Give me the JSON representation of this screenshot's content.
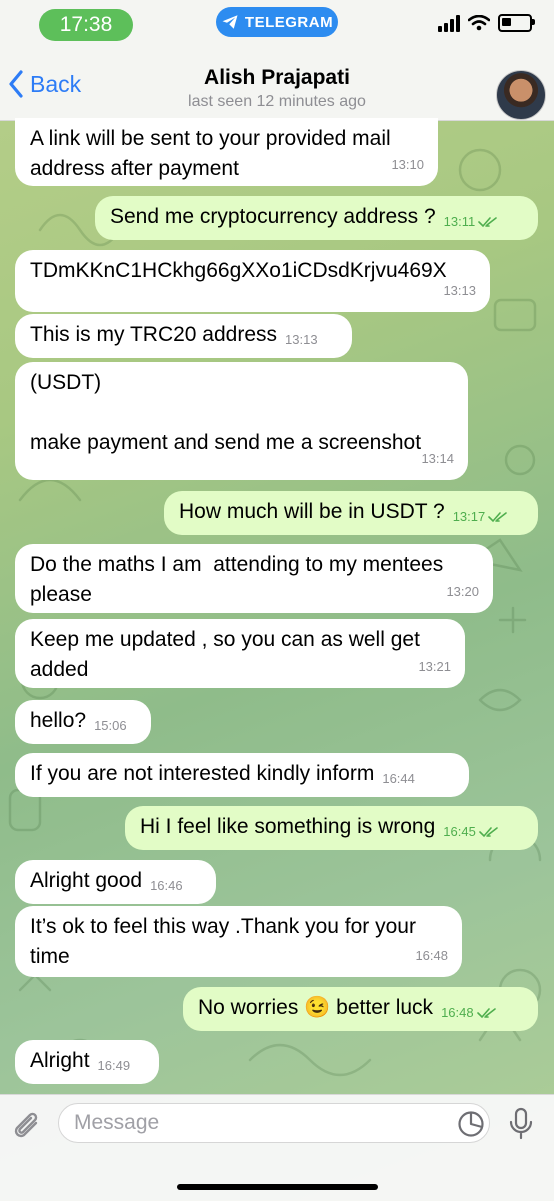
{
  "status_bar": {
    "time": "17:38",
    "app_pill": "TELEGRAM"
  },
  "header": {
    "back_label": "Back",
    "contact_name": "Alish Prajapati",
    "last_seen": "last seen 12 minutes ago"
  },
  "messages": [
    {
      "dir": "in",
      "text": "A link will be sent to your provided mail\naddress after payment",
      "time": "13:10"
    },
    {
      "dir": "out",
      "text": "Send me cryptocurrency address ?",
      "time": "13:11",
      "read": true
    },
    {
      "dir": "in",
      "text": "TDmKKnC1HCkhg66gXXo1iCDsdKrjvu469X",
      "time": "13:13"
    },
    {
      "dir": "in",
      "text": "This is my TRC20 address",
      "time": "13:13"
    },
    {
      "dir": "in",
      "text": "(USDT)\n\nmake payment and send me a screenshot",
      "time": "13:14"
    },
    {
      "dir": "out",
      "text": "How much will be in USDT ?",
      "time": "13:17",
      "read": true
    },
    {
      "dir": "in",
      "text": "Do the maths I am  attending to my mentees\nplease",
      "time": "13:20"
    },
    {
      "dir": "in",
      "text": "Keep me updated , so you can as well get\nadded",
      "time": "13:21"
    },
    {
      "dir": "in",
      "text": "hello?",
      "time": "15:06"
    },
    {
      "dir": "in",
      "text": "If you are not interested kindly inform",
      "time": "16:44"
    },
    {
      "dir": "out",
      "text": "Hi I feel like something is wrong",
      "time": "16:45",
      "read": true
    },
    {
      "dir": "in",
      "text": "Alright good",
      "time": "16:46"
    },
    {
      "dir": "in",
      "text": "It’s ok to feel this way .Thank you for your\ntime",
      "time": "16:48"
    },
    {
      "dir": "out",
      "text": "No worries 😉 better luck",
      "time": "16:48",
      "read": true
    },
    {
      "dir": "in",
      "text": "Alright",
      "time": "16:49"
    }
  ],
  "input": {
    "placeholder": "Message"
  },
  "icons": {
    "back": "chevron-left-icon",
    "telegram": "paper-plane-icon",
    "attach": "paperclip-icon",
    "sticker": "sticker-icon",
    "mic": "microphone-icon",
    "read_receipt": "double-check-icon"
  },
  "colors": {
    "accent": "#2d7cf6",
    "time_pill": "#5dbf5a",
    "telegram_pill": "#2d8cf0",
    "outgoing_bubble": "#e2fcc6",
    "incoming_bubble": "#ffffff",
    "read_check": "#4fae4e"
  }
}
